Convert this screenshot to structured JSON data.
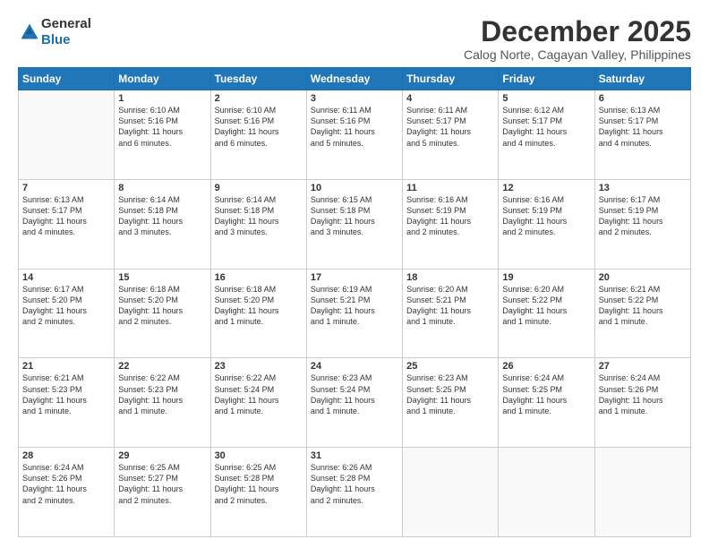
{
  "logo": {
    "general": "General",
    "blue": "Blue"
  },
  "header": {
    "month": "December 2025",
    "location": "Calog Norte, Cagayan Valley, Philippines"
  },
  "days": [
    "Sunday",
    "Monday",
    "Tuesday",
    "Wednesday",
    "Thursday",
    "Friday",
    "Saturday"
  ],
  "weeks": [
    [
      {
        "day": "",
        "info": ""
      },
      {
        "day": "1",
        "info": "Sunrise: 6:10 AM\nSunset: 5:16 PM\nDaylight: 11 hours\nand 6 minutes."
      },
      {
        "day": "2",
        "info": "Sunrise: 6:10 AM\nSunset: 5:16 PM\nDaylight: 11 hours\nand 6 minutes."
      },
      {
        "day": "3",
        "info": "Sunrise: 6:11 AM\nSunset: 5:16 PM\nDaylight: 11 hours\nand 5 minutes."
      },
      {
        "day": "4",
        "info": "Sunrise: 6:11 AM\nSunset: 5:17 PM\nDaylight: 11 hours\nand 5 minutes."
      },
      {
        "day": "5",
        "info": "Sunrise: 6:12 AM\nSunset: 5:17 PM\nDaylight: 11 hours\nand 4 minutes."
      },
      {
        "day": "6",
        "info": "Sunrise: 6:13 AM\nSunset: 5:17 PM\nDaylight: 11 hours\nand 4 minutes."
      }
    ],
    [
      {
        "day": "7",
        "info": "Sunrise: 6:13 AM\nSunset: 5:17 PM\nDaylight: 11 hours\nand 4 minutes."
      },
      {
        "day": "8",
        "info": "Sunrise: 6:14 AM\nSunset: 5:18 PM\nDaylight: 11 hours\nand 3 minutes."
      },
      {
        "day": "9",
        "info": "Sunrise: 6:14 AM\nSunset: 5:18 PM\nDaylight: 11 hours\nand 3 minutes."
      },
      {
        "day": "10",
        "info": "Sunrise: 6:15 AM\nSunset: 5:18 PM\nDaylight: 11 hours\nand 3 minutes."
      },
      {
        "day": "11",
        "info": "Sunrise: 6:16 AM\nSunset: 5:19 PM\nDaylight: 11 hours\nand 2 minutes."
      },
      {
        "day": "12",
        "info": "Sunrise: 6:16 AM\nSunset: 5:19 PM\nDaylight: 11 hours\nand 2 minutes."
      },
      {
        "day": "13",
        "info": "Sunrise: 6:17 AM\nSunset: 5:19 PM\nDaylight: 11 hours\nand 2 minutes."
      }
    ],
    [
      {
        "day": "14",
        "info": "Sunrise: 6:17 AM\nSunset: 5:20 PM\nDaylight: 11 hours\nand 2 minutes."
      },
      {
        "day": "15",
        "info": "Sunrise: 6:18 AM\nSunset: 5:20 PM\nDaylight: 11 hours\nand 2 minutes."
      },
      {
        "day": "16",
        "info": "Sunrise: 6:18 AM\nSunset: 5:20 PM\nDaylight: 11 hours\nand 1 minute."
      },
      {
        "day": "17",
        "info": "Sunrise: 6:19 AM\nSunset: 5:21 PM\nDaylight: 11 hours\nand 1 minute."
      },
      {
        "day": "18",
        "info": "Sunrise: 6:20 AM\nSunset: 5:21 PM\nDaylight: 11 hours\nand 1 minute."
      },
      {
        "day": "19",
        "info": "Sunrise: 6:20 AM\nSunset: 5:22 PM\nDaylight: 11 hours\nand 1 minute."
      },
      {
        "day": "20",
        "info": "Sunrise: 6:21 AM\nSunset: 5:22 PM\nDaylight: 11 hours\nand 1 minute."
      }
    ],
    [
      {
        "day": "21",
        "info": "Sunrise: 6:21 AM\nSunset: 5:23 PM\nDaylight: 11 hours\nand 1 minute."
      },
      {
        "day": "22",
        "info": "Sunrise: 6:22 AM\nSunset: 5:23 PM\nDaylight: 11 hours\nand 1 minute."
      },
      {
        "day": "23",
        "info": "Sunrise: 6:22 AM\nSunset: 5:24 PM\nDaylight: 11 hours\nand 1 minute."
      },
      {
        "day": "24",
        "info": "Sunrise: 6:23 AM\nSunset: 5:24 PM\nDaylight: 11 hours\nand 1 minute."
      },
      {
        "day": "25",
        "info": "Sunrise: 6:23 AM\nSunset: 5:25 PM\nDaylight: 11 hours\nand 1 minute."
      },
      {
        "day": "26",
        "info": "Sunrise: 6:24 AM\nSunset: 5:25 PM\nDaylight: 11 hours\nand 1 minute."
      },
      {
        "day": "27",
        "info": "Sunrise: 6:24 AM\nSunset: 5:26 PM\nDaylight: 11 hours\nand 1 minute."
      }
    ],
    [
      {
        "day": "28",
        "info": "Sunrise: 6:24 AM\nSunset: 5:26 PM\nDaylight: 11 hours\nand 2 minutes."
      },
      {
        "day": "29",
        "info": "Sunrise: 6:25 AM\nSunset: 5:27 PM\nDaylight: 11 hours\nand 2 minutes."
      },
      {
        "day": "30",
        "info": "Sunrise: 6:25 AM\nSunset: 5:28 PM\nDaylight: 11 hours\nand 2 minutes."
      },
      {
        "day": "31",
        "info": "Sunrise: 6:26 AM\nSunset: 5:28 PM\nDaylight: 11 hours\nand 2 minutes."
      },
      {
        "day": "",
        "info": ""
      },
      {
        "day": "",
        "info": ""
      },
      {
        "day": "",
        "info": ""
      }
    ]
  ]
}
